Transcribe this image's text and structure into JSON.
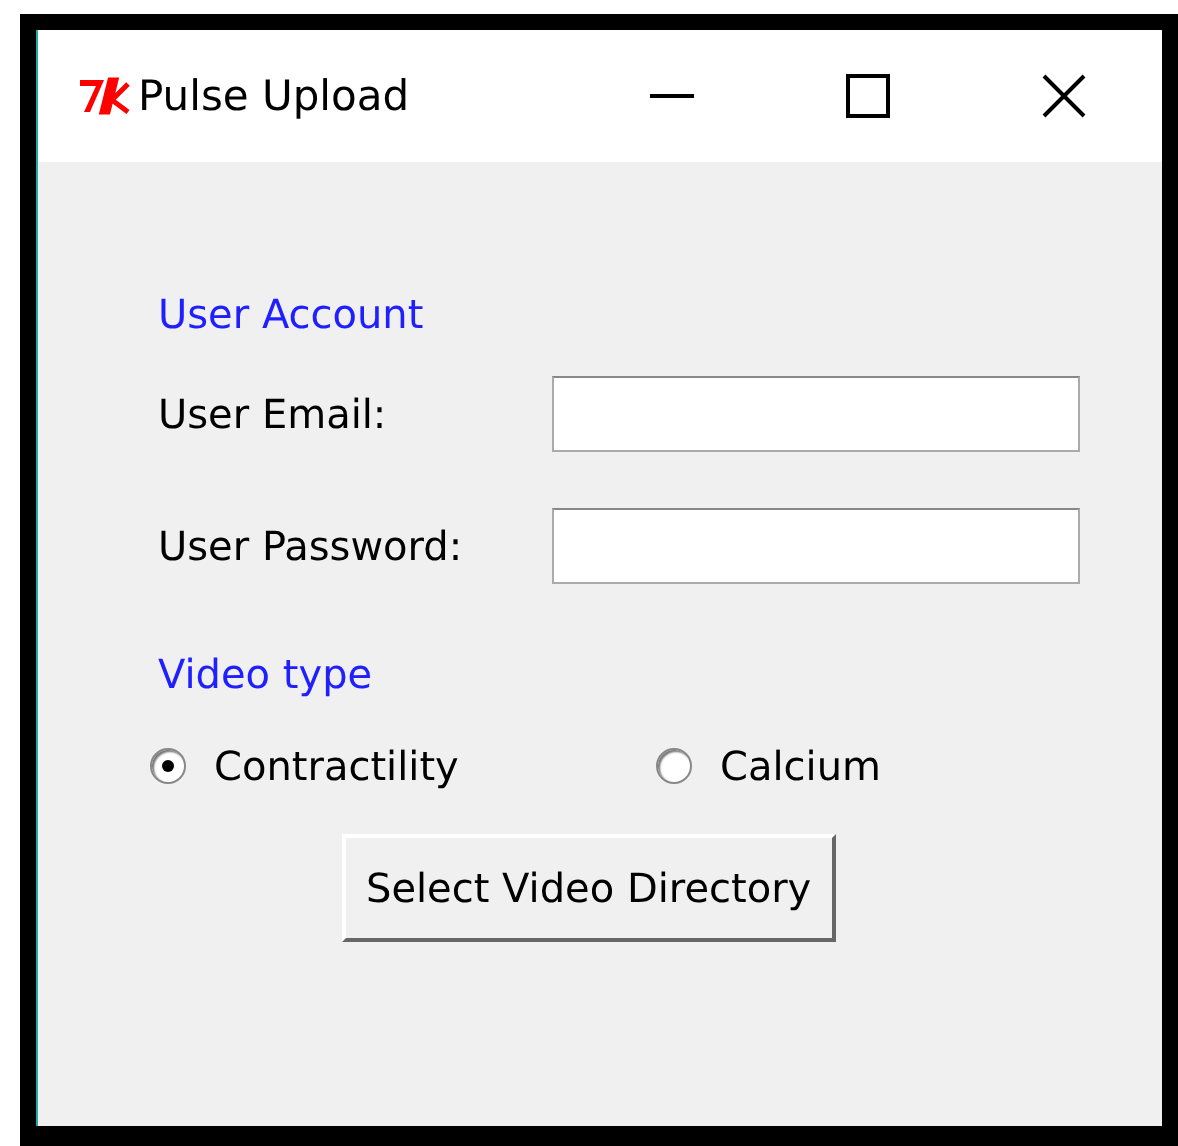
{
  "window": {
    "title": "Pulse Upload"
  },
  "sections": [
    {
      "heading": "User Account",
      "fields": [
        {
          "label": "User Email:"
        },
        {
          "label": "User Password:"
        }
      ]
    },
    {
      "heading": "Video type"
    }
  ],
  "radios": [
    {
      "label": "Contractility",
      "selected": true
    },
    {
      "label": "Calcium",
      "selected": false
    }
  ],
  "buttons": [
    "Select Video Directory"
  ]
}
